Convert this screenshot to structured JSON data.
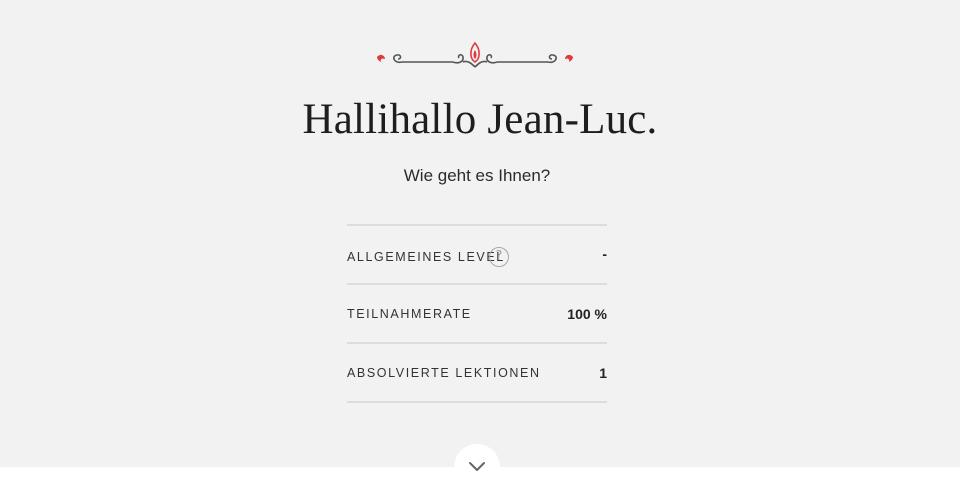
{
  "greeting": {
    "title": "Hallihallo Jean-Luc.",
    "subtitle": "Wie geht es Ihnen?"
  },
  "ornament": {
    "icon": "decorative-flourish-icon",
    "accent_color": "#e0393e",
    "line_color": "#555555"
  },
  "stats": [
    {
      "label": "Allgemeines Level",
      "value": "-",
      "help_icon": "question-mark-icon"
    },
    {
      "label": "Teilnahmerate",
      "value": "100 %"
    },
    {
      "label": "Absolvierte Lektionen",
      "value": "1"
    }
  ],
  "help": {
    "symbol": "?"
  },
  "scroll": {
    "icon": "chevron-down-icon"
  },
  "colors": {
    "background": "#f2f2f2",
    "divider": "#dcdcdc",
    "text": "#222222"
  }
}
